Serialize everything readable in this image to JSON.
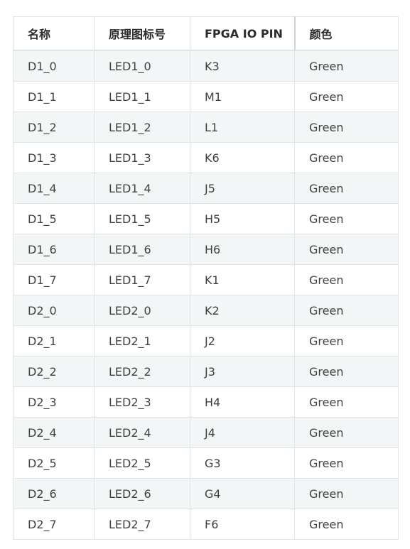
{
  "table": {
    "headers": [
      "名称",
      "原理图标号",
      "FPGA IO PIN",
      "颜色"
    ],
    "rows": [
      [
        "D1_0",
        "LED1_0",
        "K3",
        "Green"
      ],
      [
        "D1_1",
        "LED1_1",
        "M1",
        "Green"
      ],
      [
        "D1_2",
        "LED1_2",
        "L1",
        "Green"
      ],
      [
        "D1_3",
        "LED1_3",
        "K6",
        "Green"
      ],
      [
        "D1_4",
        "LED1_4",
        "J5",
        "Green"
      ],
      [
        "D1_5",
        "LED1_5",
        "H5",
        "Green"
      ],
      [
        "D1_6",
        "LED1_6",
        "H6",
        "Green"
      ],
      [
        "D1_7",
        "LED1_7",
        "K1",
        "Green"
      ],
      [
        "D2_0",
        "LED2_0",
        "K2",
        "Green"
      ],
      [
        "D2_1",
        "LED2_1",
        "J2",
        "Green"
      ],
      [
        "D2_2",
        "LED2_2",
        "J3",
        "Green"
      ],
      [
        "D2_3",
        "LED2_3",
        "H4",
        "Green"
      ],
      [
        "D2_4",
        "LED2_4",
        "J4",
        "Green"
      ],
      [
        "D2_5",
        "LED2_5",
        "G3",
        "Green"
      ],
      [
        "D2_6",
        "LED2_6",
        "G4",
        "Green"
      ],
      [
        "D2_7",
        "LED2_7",
        "F6",
        "Green"
      ]
    ]
  }
}
